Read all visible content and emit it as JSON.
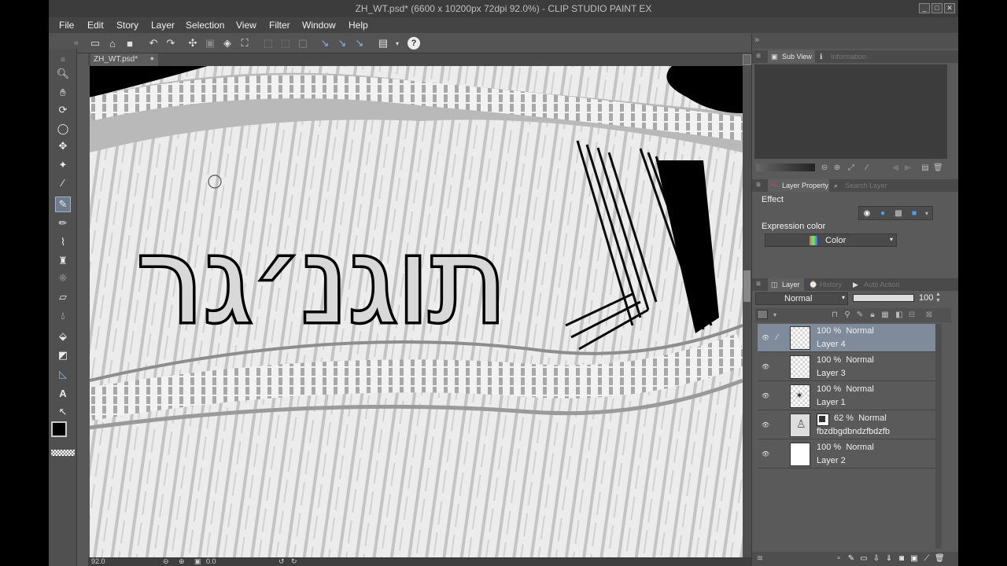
{
  "window": {
    "title": "ZH_WT.psd* (6600 x 10200px 72dpi 92.0%)  - CLIP STUDIO PAINT EX"
  },
  "menu": {
    "items": [
      "File",
      "Edit",
      "Story",
      "Layer",
      "Selection",
      "View",
      "Filter",
      "Window",
      "Help"
    ]
  },
  "document": {
    "tab_label": "ZH_WT.psd*",
    "canvas_text": "תוגנ׳גר"
  },
  "status": {
    "zoom": "92.0",
    "angle": "0.0"
  },
  "subview_panel": {
    "tabs": [
      "Sub View",
      "Information"
    ]
  },
  "layer_property_panel": {
    "tabs": [
      "Layer Property",
      "Search Layer"
    ],
    "effect_label": "Effect",
    "expression_color_label": "Expression color",
    "expression_color_value": "Color"
  },
  "layer_panel": {
    "tabs": [
      "Layer",
      "History",
      "Auto Action"
    ],
    "blend_mode": "Normal",
    "opacity": "100",
    "layers": [
      {
        "opacity": "100 %",
        "mode": "Normal",
        "name": "Layer 4",
        "selected": true
      },
      {
        "opacity": "100 %",
        "mode": "Normal",
        "name": "Layer 3",
        "selected": false
      },
      {
        "opacity": "100 %",
        "mode": "Normal",
        "name": "Layer 1",
        "selected": false
      },
      {
        "opacity": "62 %",
        "mode": "Normal",
        "name": "fbzdbgdbndzfbdzfb",
        "selected": false
      },
      {
        "opacity": "100 %",
        "mode": "Normal",
        "name": "Layer 2",
        "selected": false
      }
    ]
  },
  "colors": {
    "accent_selection": "#7f8a9a",
    "panel_bg": "#5a5a5a",
    "main_color": "#000000",
    "sub_color": "#ffffff"
  }
}
